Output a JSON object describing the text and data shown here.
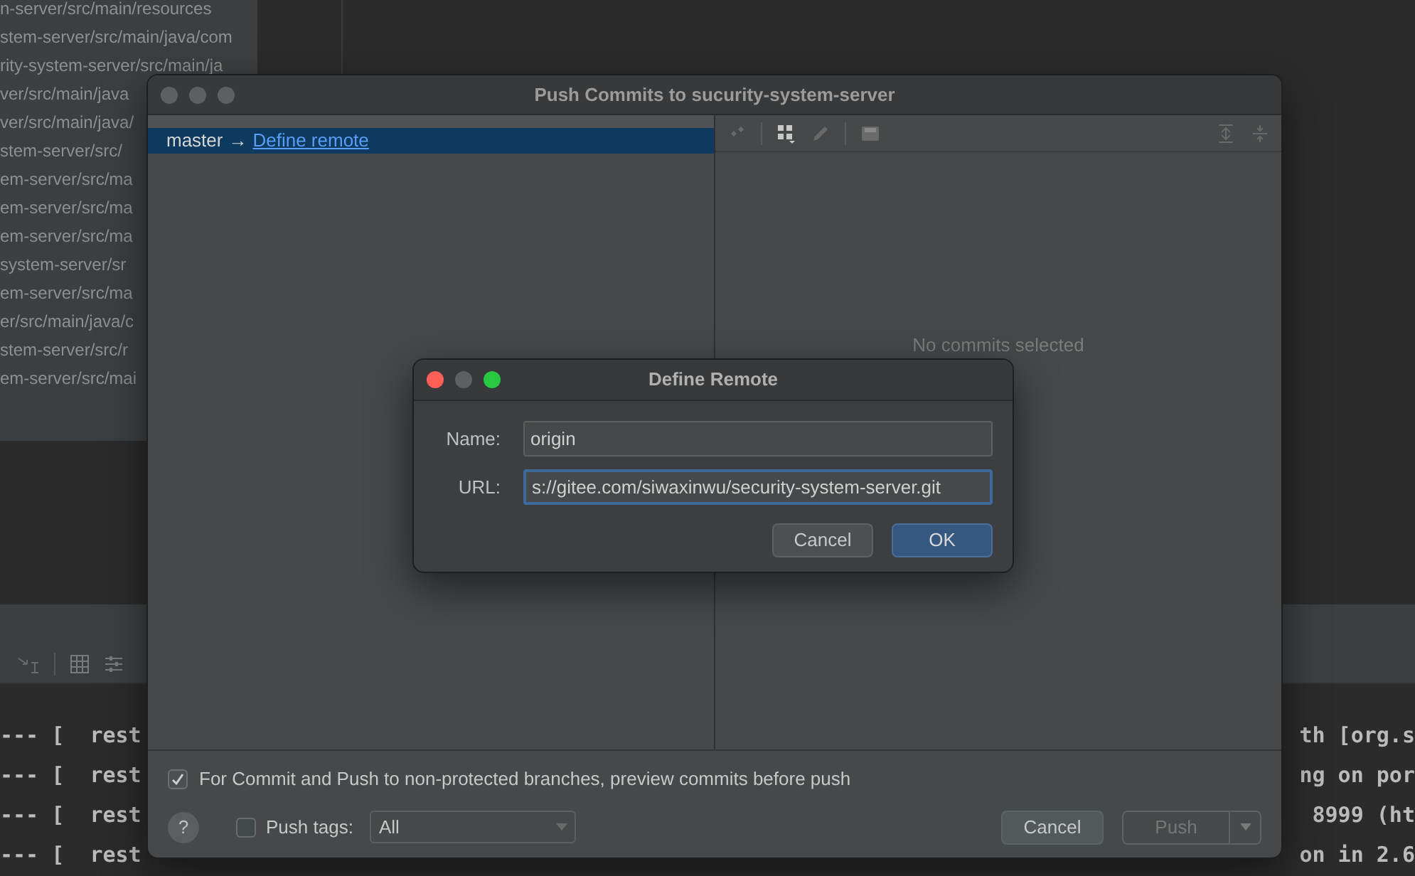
{
  "project_tree": {
    "paths": [
      "n-server/src/main/resources",
      "stem-server/src/main/java/com",
      "rity-system-server/src/main/ja",
      "ver/src/main/java",
      "ver/src/main/java/",
      "stem-server/src/",
      "em-server/src/ma",
      "em-server/src/ma",
      "em-server/src/ma",
      "system-server/sr",
      "em-server/src/ma",
      "er/src/main/java/c",
      "stem-server/src/r",
      "em-server/src/mai"
    ]
  },
  "console": {
    "left_fragments": [
      "--- [  rest",
      "--- [  rest",
      "--- [  rest",
      "--- [  rest"
    ],
    "right_fragments": [
      "th [org.s",
      "ng on por",
      " 8999 (ht",
      "on in 2.6"
    ]
  },
  "push_dialog": {
    "title": "Push Commits to sucurity-system-server",
    "branch": {
      "name": "master",
      "arrow": "→",
      "link": "Define remote",
      "selected": true
    },
    "commits_placeholder": "No commits selected",
    "preview_option": {
      "label": "For Commit and Push to non-protected branches, preview commits before push",
      "checked": true
    },
    "help": "?",
    "push_tags": {
      "label": "Push tags:",
      "checked": false,
      "value": "All"
    },
    "buttons": [
      {
        "label": "Cancel",
        "kind": "plain",
        "disabled": false
      },
      {
        "label": "Push",
        "kind": "split",
        "disabled": true
      }
    ]
  },
  "define_remote_dialog": {
    "title": "Define Remote",
    "fields": [
      {
        "label": "Name:",
        "value": "origin",
        "focused": false
      },
      {
        "label": "URL:",
        "value": "s://gitee.com/siwaxinwu/security-system-server.git",
        "focused": true
      }
    ],
    "buttons": [
      {
        "label": "Cancel",
        "default": false
      },
      {
        "label": "OK",
        "default": true
      }
    ]
  }
}
